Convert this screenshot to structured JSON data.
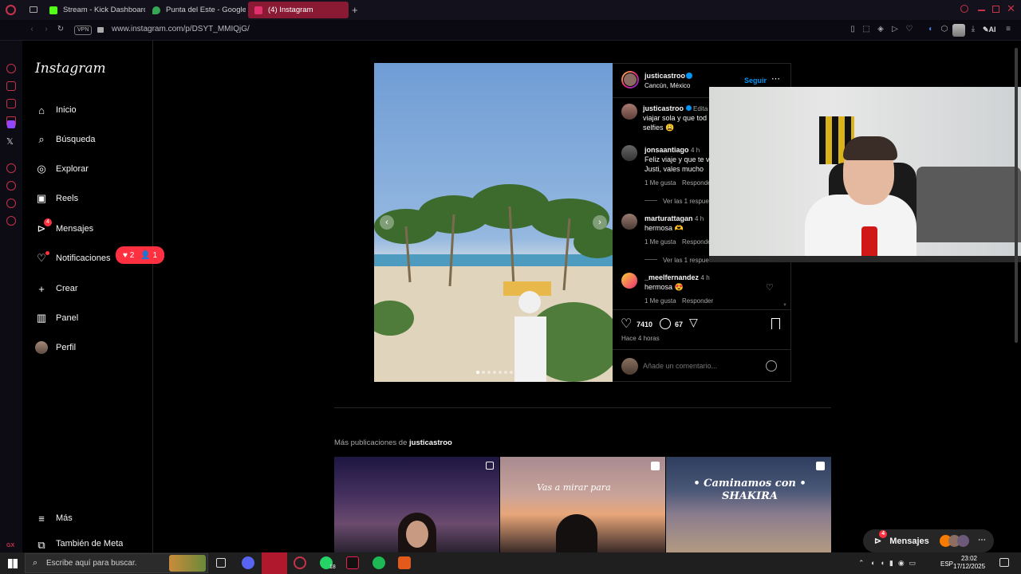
{
  "browser": {
    "tabs": [
      {
        "label": "Stream - Kick Dashboard",
        "color": "#53fc18"
      },
      {
        "label": "Punta del Este - Google M",
        "color": "#34a853"
      },
      {
        "label": "(4) Instagram",
        "color": "#e1306c"
      }
    ],
    "url": "www.instagram.com/p/DSYT_MMIQjG/",
    "vpn_label": "VPN",
    "ai_label": "AI"
  },
  "instagram": {
    "logo": "Instagram",
    "nav": [
      {
        "label": "Inicio",
        "icon": "home-icon"
      },
      {
        "label": "Búsqueda",
        "icon": "search-icon"
      },
      {
        "label": "Explorar",
        "icon": "compass-icon"
      },
      {
        "label": "Reels",
        "icon": "reels-icon"
      },
      {
        "label": "Mensajes",
        "icon": "messenger-icon",
        "badge": "4"
      },
      {
        "label": "Notificaciones",
        "icon": "heart-icon"
      },
      {
        "label": "Crear",
        "icon": "plus-icon"
      },
      {
        "label": "Panel",
        "icon": "chart-icon"
      },
      {
        "label": "Perfil",
        "icon": "avatar-icon"
      }
    ],
    "notif_pill": {
      "likes": "2",
      "follows": "1"
    },
    "more_label": "Más",
    "meta_label": "También de Meta"
  },
  "post": {
    "author": "justicastroo",
    "location": "Cancún, México",
    "follow_label": "Seguir",
    "caption_author": "justicastroo",
    "caption_edited": "Edita",
    "caption_line1": "viajar sola y que tod",
    "caption_line2": "selfies 😩",
    "comments": [
      {
        "user": "jonsaantiago",
        "time": "4 h",
        "line1": "Feliz viaje y que te v",
        "line2": "Justi, vales mucho",
        "likes": "1 Me gusta",
        "reply": "Responder",
        "replies": "Ver las 1 respue"
      },
      {
        "user": "marturattagan",
        "time": "4 h",
        "line1": "hermosa 🫶",
        "likes": "1 Me gusta",
        "reply": "Responder",
        "replies": "Ver las 1 respue"
      },
      {
        "user": "_meelfernandez",
        "time": "4 h",
        "line1": "hermosa 😍",
        "likes": "1 Me gusta",
        "reply": "Responder"
      }
    ],
    "like_count": "7410",
    "comment_count": "67",
    "posted_ago": "Hace 4 horas",
    "comment_placeholder": "Añade un comentario..."
  },
  "more_posts": {
    "label_prefix": "Más publicaciones de",
    "label_user": "justicastroo",
    "thumbs": [
      {
        "overlay": ""
      },
      {
        "overlay": "Vas a mirar para"
      },
      {
        "overlay": "• Caminamos con • SHAKIRA"
      }
    ]
  },
  "messages_floater": {
    "label": "Mensajes",
    "badge": "4"
  },
  "taskbar": {
    "search_placeholder": "Escribe aquí para buscar.",
    "lang": "ESP",
    "time": "23:02",
    "date": "17/12/2025",
    "whatsapp_badge": "18"
  },
  "colors": {
    "accent": "#0095f6",
    "notify": "#ff3040",
    "opera": "#c8324a"
  }
}
